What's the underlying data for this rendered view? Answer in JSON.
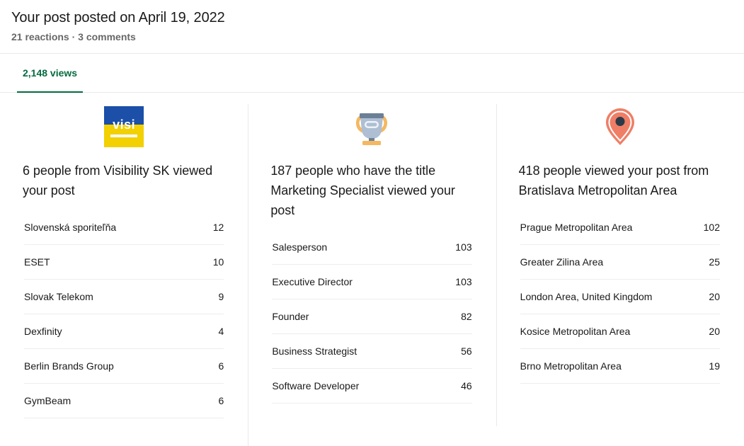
{
  "header": {
    "title": "Your post posted on April 19, 2022",
    "meta": "21 reactions · 3 comments"
  },
  "tabs": [
    {
      "label": "2,148 views",
      "active": true
    }
  ],
  "columns": [
    {
      "icon": "company-logo-visibility-sk",
      "logo_text": "visi",
      "heading": "6 people from Visibility SK viewed your post",
      "rows": [
        {
          "label": "Slovenská sporiteľňa",
          "value": "12"
        },
        {
          "label": "ESET",
          "value": "10"
        },
        {
          "label": "Slovak Telekom",
          "value": "9"
        },
        {
          "label": "Dexfinity",
          "value": "4"
        },
        {
          "label": "Berlin Brands Group",
          "value": "6"
        },
        {
          "label": "GymBeam",
          "value": "6"
        }
      ]
    },
    {
      "icon": "trophy-icon",
      "heading": "187 people who have the title Marketing Specialist viewed your post",
      "rows": [
        {
          "label": "Salesperson",
          "value": "103"
        },
        {
          "label": "Executive Director",
          "value": "103"
        },
        {
          "label": "Founder",
          "value": "82"
        },
        {
          "label": "Business Strategist",
          "value": "56"
        },
        {
          "label": "Software Developer",
          "value": "46"
        }
      ]
    },
    {
      "icon": "map-pin-icon",
      "heading": "418 people viewed your post from Bratislava Metropolitan Area",
      "rows": [
        {
          "label": "Prague Metropolitan Area",
          "value": "102"
        },
        {
          "label": "Greater Zilina Area",
          "value": "25"
        },
        {
          "label": "London Area, United Kingdom",
          "value": "20"
        },
        {
          "label": "Kosice Metropolitan Area",
          "value": "20"
        },
        {
          "label": "Brno Metropolitan Area",
          "value": "19"
        }
      ]
    }
  ],
  "colors": {
    "accent_green": "#056b3f",
    "logo_blue": "#1b4fa8",
    "logo_yellow": "#f2d001",
    "trophy_cup": "#aebfd4",
    "trophy_rim": "#6b7f96",
    "trophy_gold": "#f4b860",
    "pin_coral": "#ef7e67",
    "pin_dot": "#2b3a49"
  }
}
